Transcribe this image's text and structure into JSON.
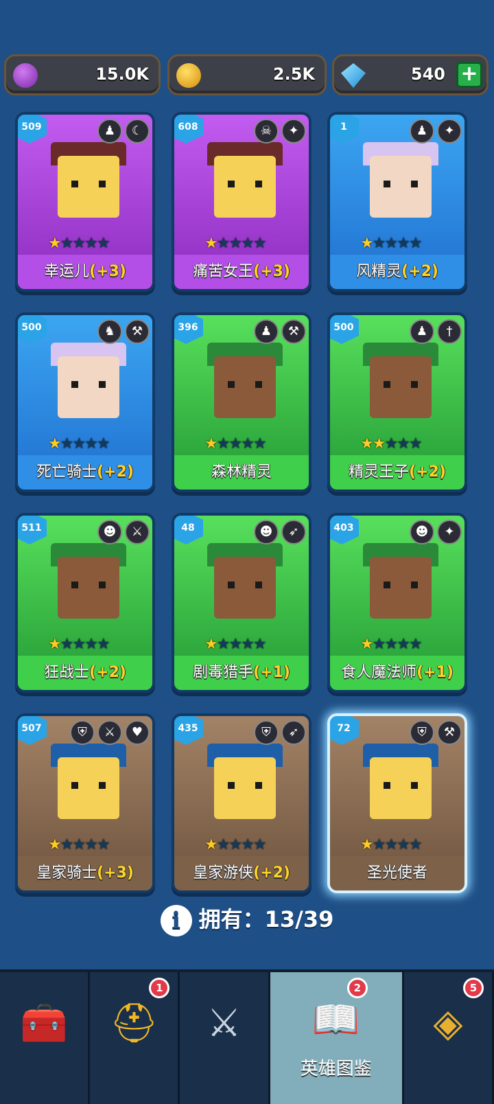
{
  "resources": {
    "elixir": {
      "value": "15.0K",
      "icon": "purple-coin-icon",
      "color": "#9b3fc8"
    },
    "gold": {
      "value": "2.5K",
      "icon": "gold-coin-icon",
      "color": "#f3b41a"
    },
    "gems": {
      "value": "540",
      "icon": "gem-icon",
      "color": "#3ab8ef",
      "add_label": "+"
    }
  },
  "heroes": [
    {
      "level": "509",
      "name": "幸运儿",
      "bonus": "(+3)",
      "stars": 1,
      "theme": "purple",
      "badges": [
        "ranger-hood-icon",
        "crescent-icon"
      ]
    },
    {
      "level": "608",
      "name": "痛苦女王",
      "bonus": "(+3)",
      "stars": 1,
      "theme": "purple",
      "badges": [
        "demon-skull-icon",
        "wand-icon"
      ]
    },
    {
      "level": "1",
      "name": "风精灵",
      "bonus": "(+2)",
      "stars": 1,
      "theme": "blue",
      "badges": [
        "ranger-hood-icon",
        "wand-icon"
      ]
    },
    {
      "level": "500",
      "name": "死亡骑士",
      "bonus": "(+2)",
      "stars": 1,
      "theme": "blue",
      "badges": [
        "horned-helmet-icon",
        "hammer-icon"
      ]
    },
    {
      "level": "396",
      "name": "森林精灵",
      "bonus": "",
      "stars": 1,
      "theme": "green",
      "badges": [
        "ranger-hood-icon",
        "hammer-icon"
      ]
    },
    {
      "level": "500",
      "name": "精灵王子",
      "bonus": "(+2)",
      "stars": 2,
      "theme": "green",
      "badges": [
        "ranger-hood-icon",
        "dagger-icon"
      ]
    },
    {
      "level": "511",
      "name": "狂战士",
      "bonus": "(+2)",
      "stars": 1,
      "theme": "green",
      "badges": [
        "orc-icon",
        "sword-icon"
      ]
    },
    {
      "level": "48",
      "name": "剧毒猎手",
      "bonus": "(+1)",
      "stars": 1,
      "theme": "green",
      "badges": [
        "orc-icon",
        "bow-icon"
      ]
    },
    {
      "level": "403",
      "name": "食人魔法师",
      "bonus": "(+1)",
      "stars": 1,
      "theme": "green",
      "badges": [
        "orc-icon",
        "wand-icon"
      ]
    },
    {
      "level": "507",
      "name": "皇家骑士",
      "bonus": "(+3)",
      "stars": 1,
      "theme": "brown",
      "badges": [
        "knight-helmet-icon",
        "sword-icon",
        "heart-icon"
      ]
    },
    {
      "level": "435",
      "name": "皇家游侠",
      "bonus": "(+2)",
      "stars": 1,
      "theme": "brown",
      "badges": [
        "knight-helmet-icon",
        "bow-icon"
      ]
    },
    {
      "level": "72",
      "name": "圣光使者",
      "bonus": "",
      "stars": 1,
      "theme": "brown",
      "badges": [
        "knight-helmet-icon",
        "hammer-icon"
      ],
      "selected": true
    }
  ],
  "owned": {
    "label": "拥有：",
    "count": "13/39"
  },
  "nav": [
    {
      "icon": "treasure-chest-icon",
      "label": "",
      "notification": ""
    },
    {
      "icon": "winged-helmet-icon",
      "label": "",
      "notification": "1"
    },
    {
      "icon": "crossed-swords-icon",
      "label": "",
      "notification": ""
    },
    {
      "icon": "hero-book-icon",
      "label": "英雄图鉴",
      "notification": "2",
      "active": true
    },
    {
      "icon": "amulet-icon",
      "label": "",
      "notification": "5"
    }
  ],
  "colors": {
    "bg": "#1e4f86",
    "purple": "#a447d6",
    "blue": "#2f8ee6",
    "green": "#3fcf4a",
    "brown": "#7d6149",
    "bonus": "#ffd426"
  }
}
